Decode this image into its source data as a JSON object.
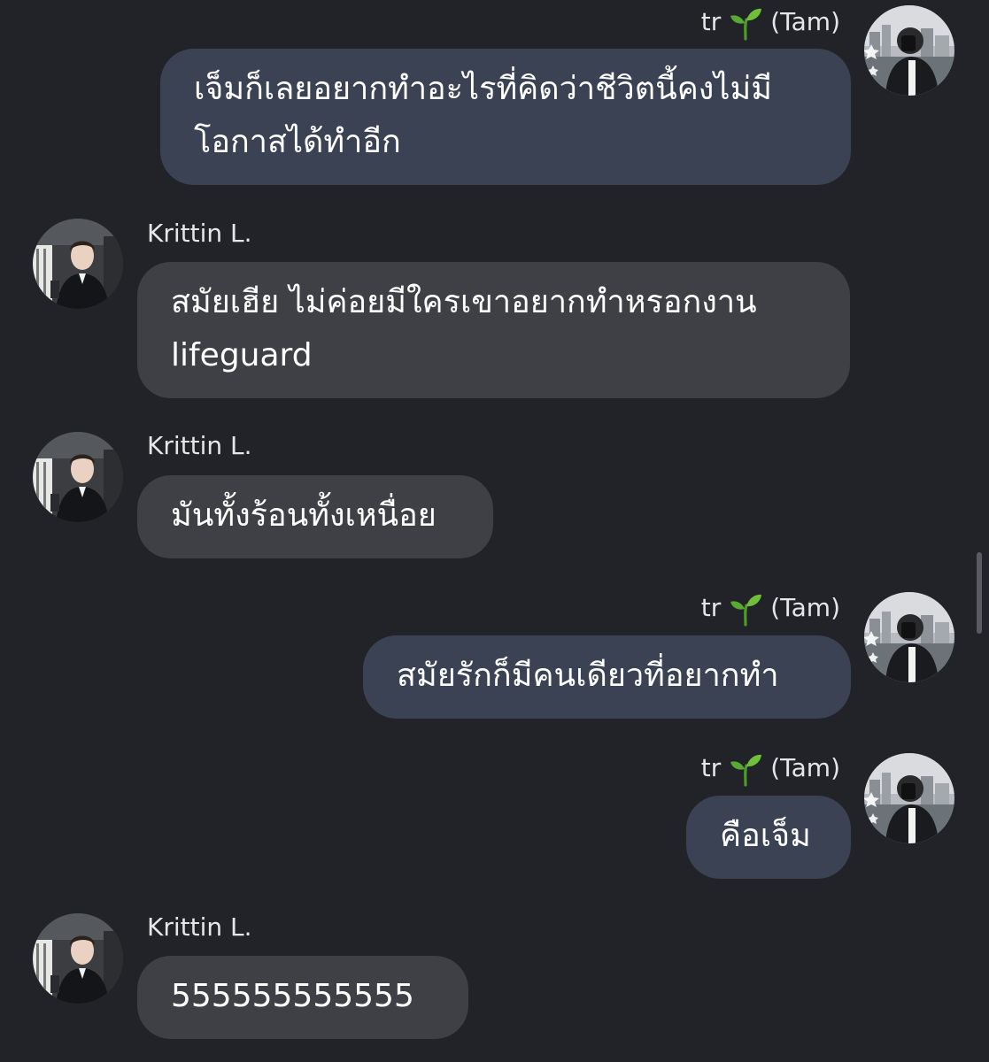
{
  "messages": [
    {
      "sender": "tr",
      "sender_suffix": "(Tam)",
      "side": "me",
      "text": "เจ็มก็เลยอยากทำอะไรที่คิดว่าชีวิตนี้คงไม่มีโอกาสได้ทำอีก"
    },
    {
      "sender": "Krittin L.",
      "side": "them",
      "text": "สมัยเฮีย ไม่ค่อยมีใครเขาอยากทำหรอกงาน lifeguard"
    },
    {
      "sender": "Krittin L.",
      "side": "them",
      "text": "มันทั้งร้อนทั้งเหนื่อย"
    },
    {
      "sender": "tr",
      "sender_suffix": "(Tam)",
      "side": "me",
      "text": "สมัยรักก็มีคนเดียวที่อยากทำ"
    },
    {
      "sender": "tr",
      "sender_suffix": "(Tam)",
      "side": "me",
      "text": "คือเจ็ม"
    },
    {
      "sender": "Krittin L.",
      "side": "them",
      "text": "555555555555"
    }
  ],
  "icons": {
    "sender_emoji": "sprout-icon",
    "avatar_me": "avatar-tam",
    "avatar_them": "avatar-krittin"
  },
  "colors": {
    "background": "#222328",
    "bubble_me": "#3a4253",
    "bubble_them": "#3f4046",
    "sprout": "#6fbf3a"
  }
}
